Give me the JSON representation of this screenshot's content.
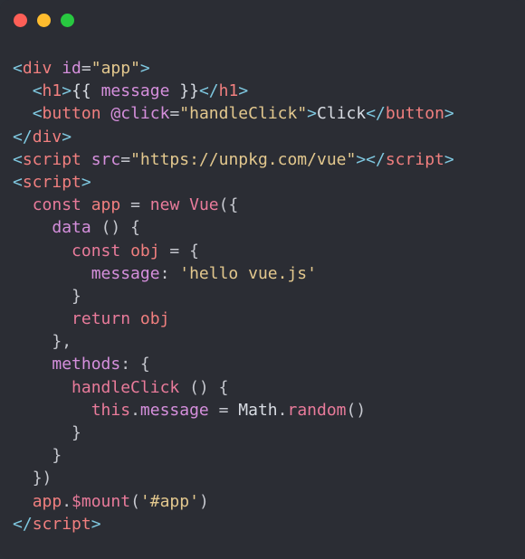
{
  "window": {
    "controls": [
      {
        "name": "close",
        "color": "#fe5f57"
      },
      {
        "name": "minimize",
        "color": "#febc2e"
      },
      {
        "name": "maximize",
        "color": "#28c840"
      }
    ]
  },
  "colors": {
    "background": "#2b2d34",
    "tag": "#f07f7f",
    "attribute": "#d58fdc",
    "string": "#e3c88e",
    "keyword": "#e97b9b",
    "punctuation": "#c6c8cf",
    "plain": "#d8dce3",
    "bracket": "#7fc8e0"
  },
  "code": {
    "lines": [
      [
        [
          "t-bracket",
          "<"
        ],
        [
          "t-tag",
          "div"
        ],
        [
          "t-plain",
          " "
        ],
        [
          "t-attr",
          "id"
        ],
        [
          "t-punct",
          "="
        ],
        [
          "t-str",
          "\"app\""
        ],
        [
          "t-bracket",
          ">"
        ]
      ],
      [
        [
          "t-plain",
          "  "
        ],
        [
          "t-bracket",
          "<"
        ],
        [
          "t-tag",
          "h1"
        ],
        [
          "t-bracket",
          ">"
        ],
        [
          "t-plain",
          "{{ "
        ],
        [
          "t-attr",
          "message"
        ],
        [
          "t-plain",
          " }}"
        ],
        [
          "t-bracket",
          "</"
        ],
        [
          "t-tag",
          "h1"
        ],
        [
          "t-bracket",
          ">"
        ]
      ],
      [
        [
          "t-plain",
          "  "
        ],
        [
          "t-bracket",
          "<"
        ],
        [
          "t-tag",
          "button"
        ],
        [
          "t-plain",
          " "
        ],
        [
          "t-attr",
          "@click"
        ],
        [
          "t-punct",
          "="
        ],
        [
          "t-str",
          "\"handleClick\""
        ],
        [
          "t-bracket",
          ">"
        ],
        [
          "t-plain",
          "Click"
        ],
        [
          "t-bracket",
          "</"
        ],
        [
          "t-tag",
          "button"
        ],
        [
          "t-bracket",
          ">"
        ]
      ],
      [
        [
          "t-bracket",
          "</"
        ],
        [
          "t-tag",
          "div"
        ],
        [
          "t-bracket",
          ">"
        ]
      ],
      [
        [
          "t-bracket",
          "<"
        ],
        [
          "t-tag",
          "script"
        ],
        [
          "t-plain",
          " "
        ],
        [
          "t-attr",
          "src"
        ],
        [
          "t-punct",
          "="
        ],
        [
          "t-str",
          "\"https://unpkg.com/vue\""
        ],
        [
          "t-bracket",
          "></"
        ],
        [
          "t-tag",
          "script"
        ],
        [
          "t-bracket",
          ">"
        ]
      ],
      [
        [
          "t-bracket",
          "<"
        ],
        [
          "t-tag",
          "script"
        ],
        [
          "t-bracket",
          ">"
        ]
      ],
      [
        [
          "t-plain",
          "  "
        ],
        [
          "t-kw",
          "const"
        ],
        [
          "t-plain",
          " "
        ],
        [
          "t-var",
          "app"
        ],
        [
          "t-plain",
          " "
        ],
        [
          "t-punct",
          "="
        ],
        [
          "t-plain",
          " "
        ],
        [
          "t-kw",
          "new"
        ],
        [
          "t-plain",
          " "
        ],
        [
          "t-fn",
          "Vue"
        ],
        [
          "t-punct",
          "({"
        ]
      ],
      [
        [
          "t-plain",
          "    "
        ],
        [
          "t-prop",
          "data"
        ],
        [
          "t-plain",
          " "
        ],
        [
          "t-punct",
          "() {"
        ]
      ],
      [
        [
          "t-plain",
          "      "
        ],
        [
          "t-kw",
          "const"
        ],
        [
          "t-plain",
          " "
        ],
        [
          "t-var",
          "obj"
        ],
        [
          "t-plain",
          " "
        ],
        [
          "t-punct",
          "="
        ],
        [
          "t-plain",
          " "
        ],
        [
          "t-punct",
          "{"
        ]
      ],
      [
        [
          "t-plain",
          "        "
        ],
        [
          "t-prop",
          "message"
        ],
        [
          "t-punct",
          ":"
        ],
        [
          "t-plain",
          " "
        ],
        [
          "t-str",
          "'hello vue.js'"
        ]
      ],
      [
        [
          "t-plain",
          "      "
        ],
        [
          "t-punct",
          "}"
        ]
      ],
      [
        [
          "t-plain",
          "      "
        ],
        [
          "t-kw",
          "return"
        ],
        [
          "t-plain",
          " "
        ],
        [
          "t-var",
          "obj"
        ]
      ],
      [
        [
          "t-plain",
          "    "
        ],
        [
          "t-punct",
          "},"
        ]
      ],
      [
        [
          "t-plain",
          "    "
        ],
        [
          "t-prop",
          "methods"
        ],
        [
          "t-punct",
          ":"
        ],
        [
          "t-plain",
          " "
        ],
        [
          "t-punct",
          "{"
        ]
      ],
      [
        [
          "t-plain",
          "      "
        ],
        [
          "t-fn",
          "handleClick"
        ],
        [
          "t-plain",
          " "
        ],
        [
          "t-punct",
          "() {"
        ]
      ],
      [
        [
          "t-plain",
          "        "
        ],
        [
          "t-kw",
          "this"
        ],
        [
          "t-punct",
          "."
        ],
        [
          "t-attr",
          "message"
        ],
        [
          "t-plain",
          " "
        ],
        [
          "t-punct",
          "="
        ],
        [
          "t-plain",
          " "
        ],
        [
          "t-plain",
          "Math"
        ],
        [
          "t-punct",
          "."
        ],
        [
          "t-fn",
          "random"
        ],
        [
          "t-punct",
          "()"
        ]
      ],
      [
        [
          "t-plain",
          "      "
        ],
        [
          "t-punct",
          "}"
        ]
      ],
      [
        [
          "t-plain",
          "    "
        ],
        [
          "t-punct",
          "}"
        ]
      ],
      [
        [
          "t-plain",
          "  "
        ],
        [
          "t-punct",
          "})"
        ]
      ],
      [
        [
          "t-plain",
          "  "
        ],
        [
          "t-var",
          "app"
        ],
        [
          "t-punct",
          "."
        ],
        [
          "t-fn",
          "$mount"
        ],
        [
          "t-punct",
          "("
        ],
        [
          "t-str",
          "'#app'"
        ],
        [
          "t-punct",
          ")"
        ]
      ],
      [
        [
          "t-bracket",
          "</"
        ],
        [
          "t-tag",
          "script"
        ],
        [
          "t-bracket",
          ">"
        ]
      ]
    ]
  }
}
